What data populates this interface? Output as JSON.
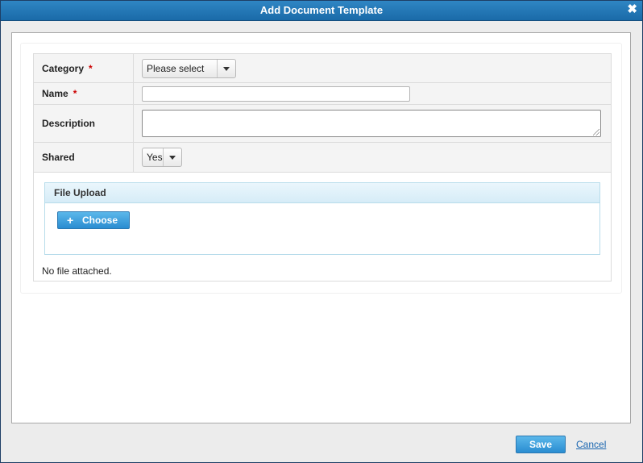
{
  "dialog": {
    "title": "Add Document Template",
    "close_icon": "✖"
  },
  "form": {
    "category": {
      "label": "Category",
      "required_mark": "*",
      "value": "Please select"
    },
    "name": {
      "label": "Name",
      "required_mark": "*",
      "value": ""
    },
    "description": {
      "label": "Description",
      "value": ""
    },
    "shared": {
      "label": "Shared",
      "value": "Yes"
    }
  },
  "upload": {
    "header": "File Upload",
    "choose_icon": "+",
    "choose_label": "Choose",
    "status": "No file attached."
  },
  "footer": {
    "save_label": "Save",
    "cancel_label": "Cancel"
  },
  "colors": {
    "titlebar": "#2f86c4",
    "button": "#3a9edd",
    "link": "#1a66b0",
    "required": "#cc0000"
  }
}
